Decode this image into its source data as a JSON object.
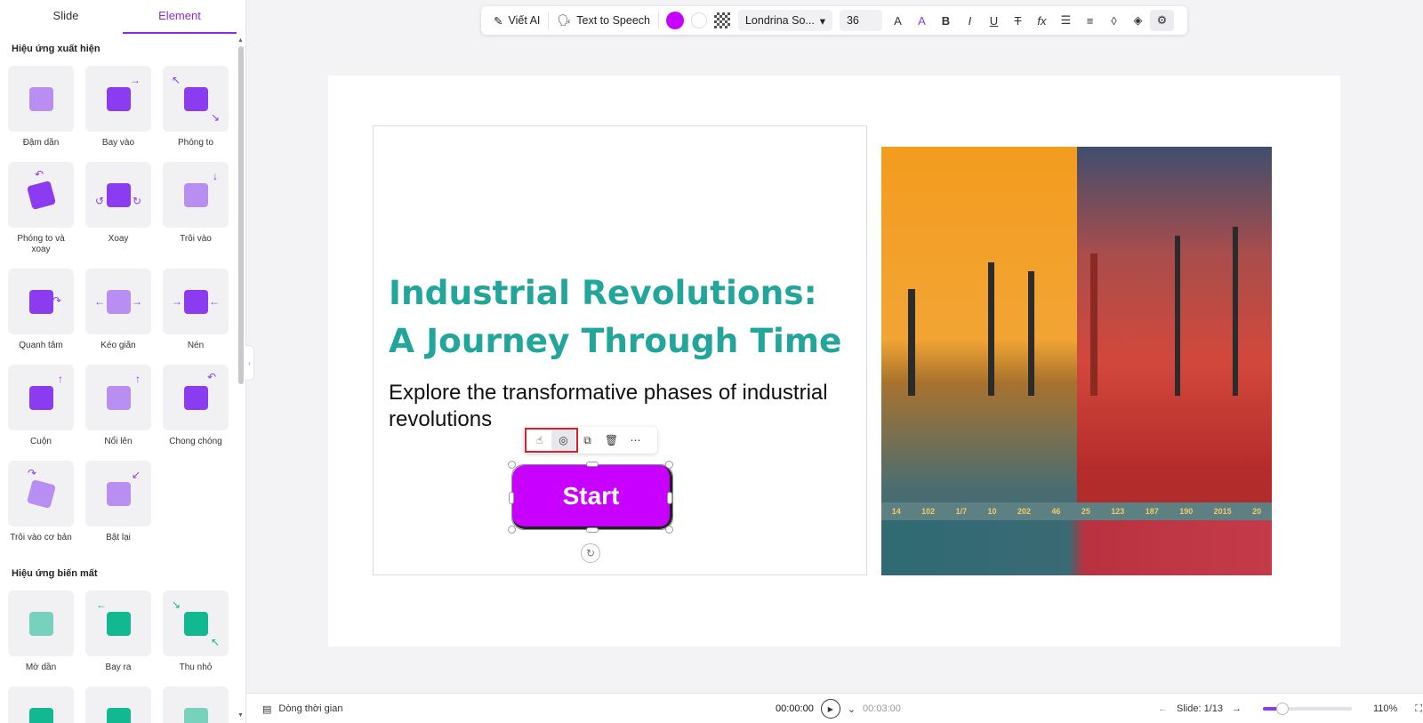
{
  "panel": {
    "tabs": [
      "Slide",
      "Element"
    ],
    "active_tab": "Element",
    "appear_title": "Hiệu ứng xuất hiện",
    "appear_effects": [
      "Đậm dần",
      "Bay vào",
      "Phóng to",
      "Phóng to và xoay",
      "Xoay",
      "Trôi vào",
      "Quanh tâm",
      "Kéo giãn",
      "Nén",
      "Cuộn",
      "Nổi lên",
      "Chong chóng",
      "Trôi vào cơ bản",
      "Bật lại"
    ],
    "disappear_title": "Hiệu ứng biến mất",
    "disappear_effects": [
      "Mờ dần",
      "Bay ra",
      "Thu nhỏ"
    ]
  },
  "toolbar": {
    "write_ai": "Viết AI",
    "tts": "Text to Speech",
    "text_color": "#c800ff",
    "font_name": "Londrina So...",
    "font_size": "36"
  },
  "slide": {
    "title": "Industrial Revolutions: A Journey Through Time",
    "subtitle": "Explore the transformative phases of industrial revolutions",
    "button_label": "Start",
    "title_color": "#22a59a",
    "button_color": "#c800ff",
    "picture_numbers": [
      "14",
      "102",
      "1/7",
      "10",
      "202",
      "46",
      "25",
      "123",
      "187",
      "190",
      "2015",
      "20"
    ]
  },
  "bottom": {
    "timeline": "Dòng thời gian",
    "current_time": "00:00:00",
    "total_time": "00:03:00",
    "slide_indicator": "Slide: 1/13",
    "zoom": "110%",
    "zoom_level_fraction": 0.22
  }
}
